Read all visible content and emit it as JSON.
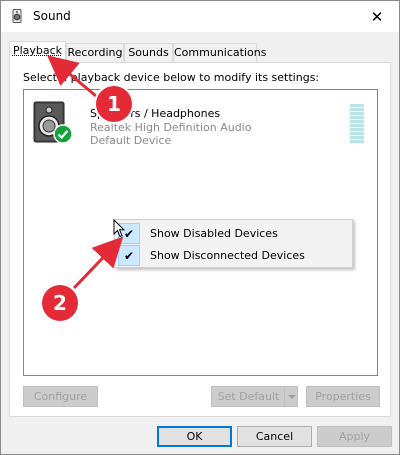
{
  "window": {
    "title": "Sound",
    "close_glyph": "✕"
  },
  "tabs": [
    {
      "label": "Playback",
      "active": true
    },
    {
      "label": "Recording",
      "active": false
    },
    {
      "label": "Sounds",
      "active": false
    },
    {
      "label": "Communications",
      "active": false
    }
  ],
  "instruction": "Select a playback device below to modify its settings:",
  "device": {
    "name": "Speakers / Headphones",
    "description": "Realtek High Definition Audio",
    "status": "Default Device",
    "icon": "speaker-icon",
    "status_icon": "green-check-icon"
  },
  "context_menu": {
    "items": [
      {
        "label": "Show Disabled Devices",
        "checked": true
      },
      {
        "label": "Show Disconnected Devices",
        "checked": true
      }
    ]
  },
  "buttons": {
    "configure": "Configure",
    "set_default": "Set Default",
    "properties": "Properties",
    "ok": "OK",
    "cancel": "Cancel",
    "apply": "Apply"
  },
  "annotations": {
    "badge_1": "1",
    "badge_2": "2",
    "color": "#e32a36"
  }
}
